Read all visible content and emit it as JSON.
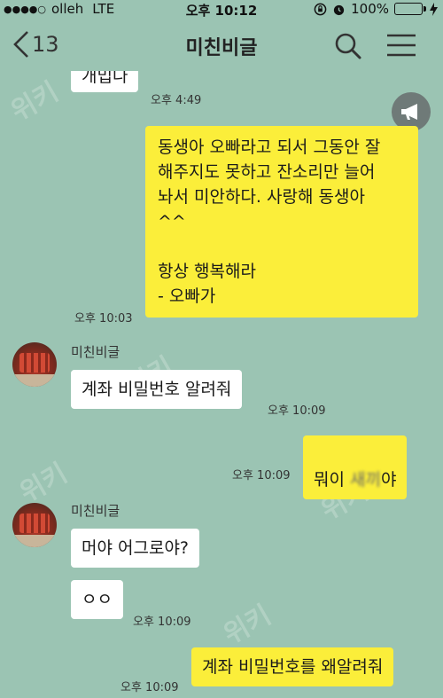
{
  "status_bar": {
    "carrier": "olleh",
    "network": "LTE",
    "time": "오후 10:12",
    "battery": "100%"
  },
  "header": {
    "back_count": "13",
    "title": "미친비글"
  },
  "messages": {
    "m0": {
      "text": "개밉나",
      "time": "오후 4:49"
    },
    "m1": {
      "text": "동생아 오빠라고 되서 그동안 잘\n해주지도 못하고 잔소리만 늘어\n놔서 미안하다. 사랑해 동생아\n^^\n\n항상 행복해라\n- 오빠가",
      "time": "오후 10:03"
    },
    "m2": {
      "sender": "미친비글",
      "text": "계좌 비밀번호 알려줘",
      "time": "오후 10:09"
    },
    "m3": {
      "text_prefix": "뭐이 ",
      "text_blurred": "새끼",
      "text_suffix": "야",
      "time": "오후 10:09"
    },
    "m4": {
      "sender": "미친비글",
      "text": "머야 어그로야?"
    },
    "m5": {
      "text": "ㅇㅇ",
      "time": "오후 10:09"
    },
    "m6": {
      "text": "계좌 비밀번호를 왜알려줘",
      "time": "오후 10:09"
    }
  },
  "watermark": "위키",
  "icons": [
    "back-chevron-icon",
    "search-icon",
    "menu-icon",
    "megaphone-icon",
    "alarm-icon",
    "lock-rotation-icon",
    "battery-icon",
    "charging-icon"
  ],
  "colors": {
    "background": "#9bc4b3",
    "outgoing_bubble": "#fbee3a",
    "incoming_bubble": "#ffffff"
  }
}
